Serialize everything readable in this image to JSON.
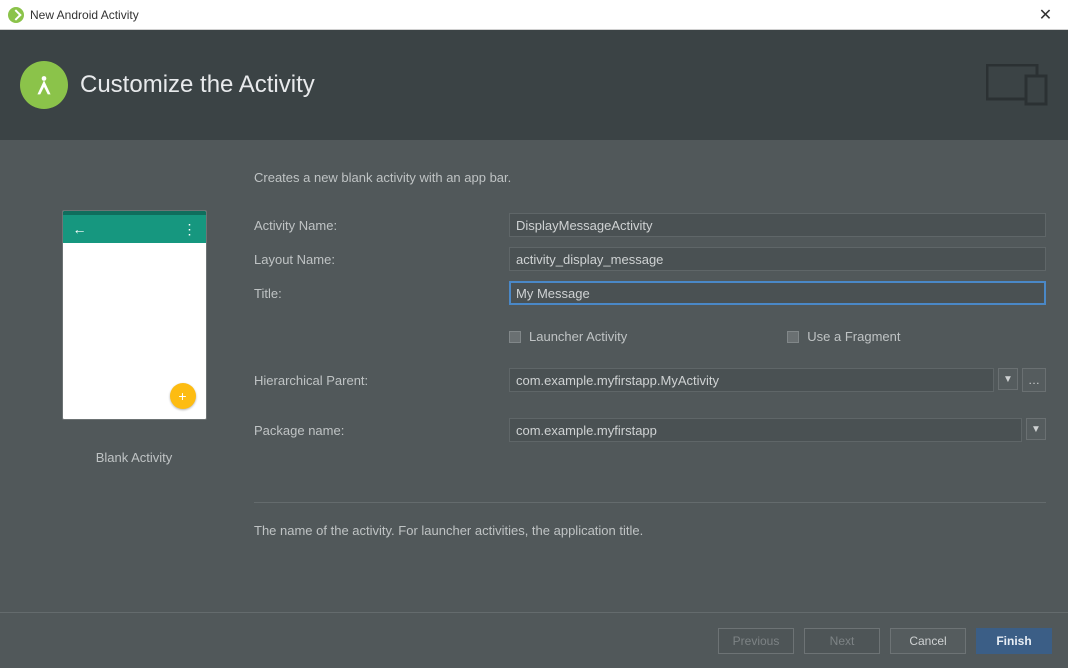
{
  "window": {
    "title": "New Android Activity"
  },
  "banner": {
    "heading": "Customize the Activity"
  },
  "form": {
    "description": "Creates a new blank activity with an app bar.",
    "activity_name_label": "Activity Name:",
    "activity_name_value": "DisplayMessageActivity",
    "layout_name_label": "Layout Name:",
    "layout_name_value": "activity_display_message",
    "title_label": "Title:",
    "title_value": "My Message",
    "launcher_label": "Launcher Activity",
    "fragment_label": "Use a Fragment",
    "hier_parent_label": "Hierarchical Parent:",
    "hier_parent_value": "com.example.myfirstapp.MyActivity",
    "package_label": "Package name:",
    "package_value": "com.example.myfirstapp",
    "help_text": "The name of the activity. For launcher activities, the application title."
  },
  "preview": {
    "caption": "Blank Activity"
  },
  "buttons": {
    "previous": "Previous",
    "next": "Next",
    "cancel": "Cancel",
    "finish": "Finish"
  }
}
